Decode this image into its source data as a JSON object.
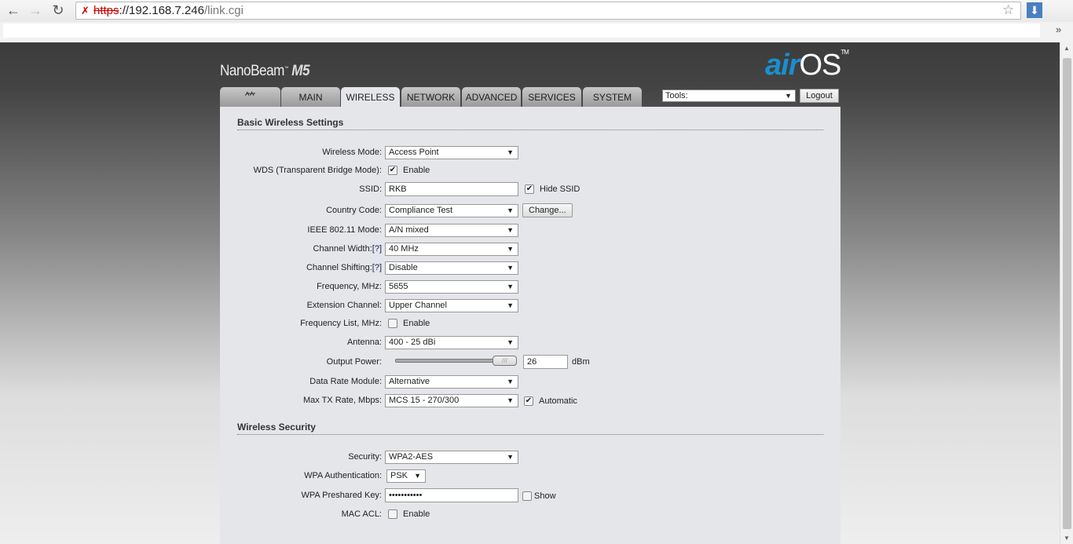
{
  "browser": {
    "url_scheme": "https",
    "url_host": "://192.168.7.246",
    "url_path": "/link.cgi",
    "bookmarks_more": "»"
  },
  "header": {
    "product": "NanoBeam",
    "product_tm": "™",
    "model": "M5",
    "logo_air": "air",
    "logo_os": "OS",
    "logo_tm": "TM"
  },
  "tabs": [
    {
      "label": "",
      "icon": "ubiquiti-logo-icon"
    },
    {
      "label": "MAIN"
    },
    {
      "label": "WIRELESS",
      "active": true
    },
    {
      "label": "NETWORK"
    },
    {
      "label": "ADVANCED"
    },
    {
      "label": "SERVICES"
    },
    {
      "label": "SYSTEM"
    }
  ],
  "tools": {
    "value": "Tools:",
    "logout": "Logout"
  },
  "basic": {
    "title": "Basic Wireless Settings",
    "wireless_mode": {
      "label": "Wireless Mode:",
      "value": "Access Point"
    },
    "wds": {
      "label": "WDS (Transparent Bridge Mode):",
      "cb_label": "Enable",
      "checked": true
    },
    "ssid": {
      "label": "SSID:",
      "value": "RKB",
      "hide_label": "Hide SSID",
      "hide_checked": true
    },
    "country": {
      "label": "Country Code:",
      "value": "Compliance Test",
      "button": "Change..."
    },
    "ieee": {
      "label": "IEEE 802.11 Mode:",
      "value": "A/N mixed"
    },
    "width": {
      "label": "Channel Width:",
      "help": "[?]",
      "value": "40 MHz"
    },
    "shifting": {
      "label": "Channel Shifting:",
      "help": "[?]",
      "value": "Disable"
    },
    "frequency": {
      "label": "Frequency, MHz:",
      "value": "5655"
    },
    "extension": {
      "label": "Extension Channel:",
      "value": "Upper Channel"
    },
    "freq_list": {
      "label": "Frequency List, MHz:",
      "cb_label": "Enable",
      "checked": false
    },
    "antenna": {
      "label": "Antenna:",
      "value": "400 - 25 dBi"
    },
    "output_power": {
      "label": "Output Power:",
      "value": "26",
      "unit": "dBm",
      "slider_fraction": 1.0
    },
    "data_rate": {
      "label": "Data Rate Module:",
      "value": "Alternative"
    },
    "max_tx": {
      "label": "Max TX Rate, Mbps:",
      "value": "MCS 15 - 270/300",
      "auto_label": "Automatic",
      "auto_checked": true
    }
  },
  "security": {
    "title": "Wireless Security",
    "security": {
      "label": "Security:",
      "value": "WPA2-AES"
    },
    "auth": {
      "label": "WPA Authentication:",
      "value": "PSK"
    },
    "key": {
      "label": "WPA Preshared Key:",
      "value": "•••••••••••",
      "show_label": "Show",
      "show_checked": false
    },
    "mac_acl": {
      "label": "MAC ACL:",
      "cb_label": "Enable",
      "checked": false
    }
  }
}
